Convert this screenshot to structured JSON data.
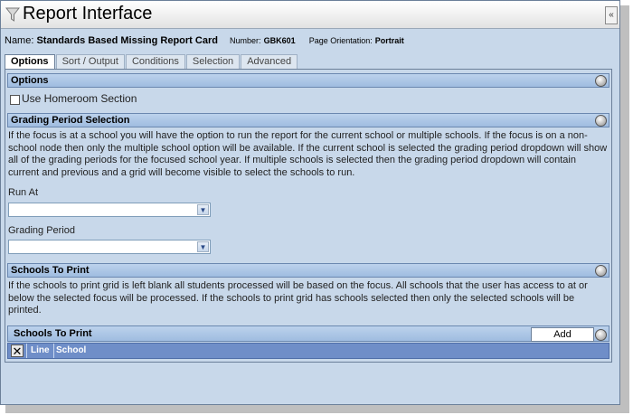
{
  "window": {
    "title": "Report Interface",
    "collapse_glyph": "«"
  },
  "report": {
    "name_label": "Name:",
    "name_value": "Standards Based Missing Report Card",
    "number_label": "Number:",
    "number_value": "GBK601",
    "orientation_label": "Page Orientation:",
    "orientation_value": "Portrait"
  },
  "tabs": [
    {
      "label": "Options",
      "active": true
    },
    {
      "label": "Sort / Output",
      "active": false
    },
    {
      "label": "Conditions",
      "active": false
    },
    {
      "label": "Selection",
      "active": false
    },
    {
      "label": "Advanced",
      "active": false
    }
  ],
  "options_section": {
    "header": "Options",
    "homeroom_label": "Use Homeroom Section",
    "homeroom_checked": false
  },
  "grading_section": {
    "header": "Grading Period Selection",
    "description": "If the focus is at a school you will have the option to run the report for the current school or multiple schools. If the focus is on a non-school node then only the multiple school option will be available. If the current school is selected the grading period dropdown will show all of the grading periods for the focused school year. If multiple schools is selected then the grading period dropdown will contain current and previous and a grid will become visible to select the schools to run.",
    "run_at_label": "Run At",
    "run_at_value": "",
    "grading_period_label": "Grading Period",
    "grading_period_value": ""
  },
  "schools_section": {
    "header": "Schools To Print",
    "description": "If the schools to print grid is left blank all students processed will be based on the focus. All schools that the user has access to at or below the selected focus will be processed. If the schools to print grid has schools selected then only the selected schools will be printed.",
    "grid_title": "Schools To Print",
    "add_label": "Add",
    "grid_delete_glyph": "✕",
    "columns": [
      "Line",
      "School"
    ]
  },
  "icons": {
    "title_icon": "filter-funnel-icon",
    "section_icon": "circle-toggle-icon",
    "dropdown_icon": "chevron-down-icon"
  },
  "colors": {
    "window_bg": "#c8d8ea",
    "section_header": "#9fbce0",
    "grid_header": "#6f8ec8"
  }
}
